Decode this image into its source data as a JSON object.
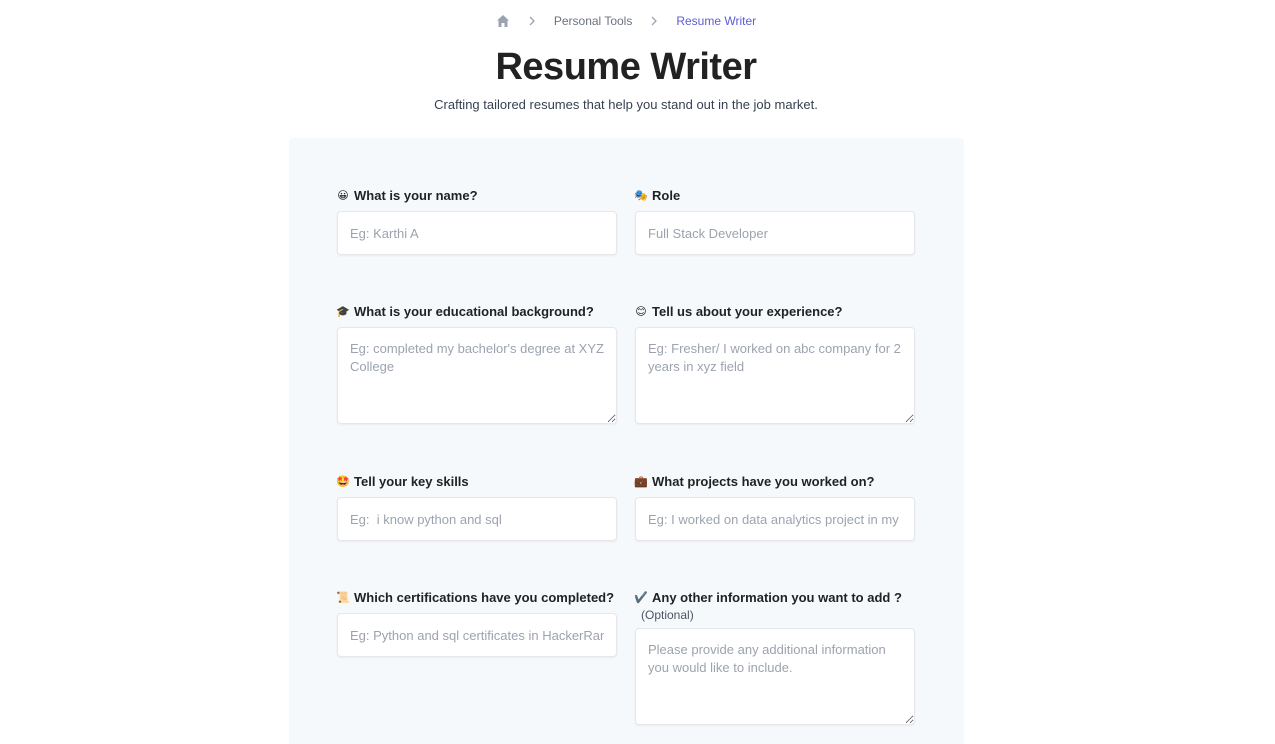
{
  "breadcrumb": {
    "home_icon": "home-icon",
    "items": [
      "Personal Tools",
      "Resume Writer"
    ]
  },
  "header": {
    "title": "Resume Writer",
    "subtitle": "Crafting tailored resumes that help you stand out in the job market."
  },
  "colors": {
    "accent": "#5b5bd6",
    "panel_bg": "#f6f9fc",
    "placeholder": "#9ca3af"
  },
  "form": {
    "name": {
      "emoji": "😀",
      "label": "What is your name?",
      "placeholder": "Eg: Karthi A",
      "value": ""
    },
    "role": {
      "emoji": "🎭",
      "label": "Role",
      "placeholder": "Full Stack Developer",
      "value": ""
    },
    "education": {
      "emoji": "🎓",
      "label": "What is your educational background?",
      "placeholder": "Eg: completed my bachelor's degree at XYZ College",
      "value": ""
    },
    "experience": {
      "emoji": "😊",
      "label": "Tell us about your experience?",
      "placeholder": "Eg: Fresher/ I worked on abc company for 2 years in xyz field",
      "value": ""
    },
    "skills": {
      "emoji": "🤩",
      "label": "Tell your key skills",
      "placeholder": "Eg:  i know python and sql",
      "value": ""
    },
    "projects": {
      "emoji": "💼",
      "label": "What projects have you worked on?",
      "placeholder": "Eg: I worked on data analytics project in my college",
      "value": ""
    },
    "certifications": {
      "emoji": "📜",
      "label": "Which certifications have you completed?",
      "placeholder": "Eg: Python and sql certificates in HackerRank",
      "value": ""
    },
    "other": {
      "emoji": "✔️",
      "label": "Any other information you want to add ?",
      "optional": "(Optional)",
      "placeholder": "Please provide any additional information you would like to include.",
      "value": ""
    }
  }
}
